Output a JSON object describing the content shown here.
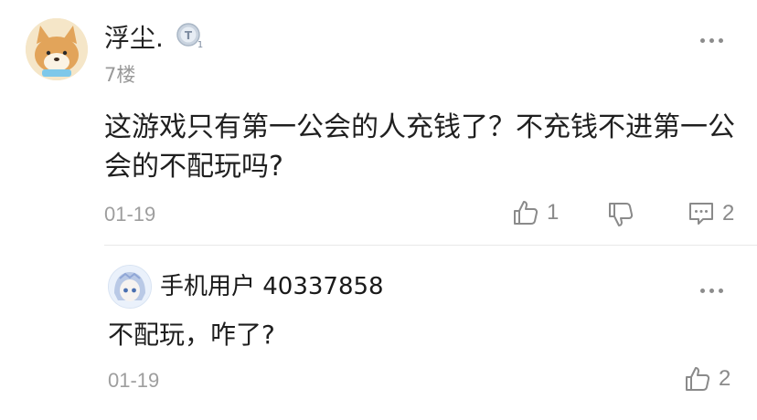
{
  "comment": {
    "username": "浮尘.",
    "badge_icon": "level-badge-icon",
    "floor": "7楼",
    "text": "这游戏只有第一公会的人充钱了？不充钱不进第一公会的不配玩吗?",
    "date": "01-19",
    "like_count": "1",
    "reply_count": "2"
  },
  "reply": {
    "username": "手机用户 40337858",
    "text": "不配玩，咋了?",
    "date": "01-19",
    "like_count": "2"
  },
  "colors": {
    "text_primary": "#1f1f1f",
    "text_secondary": "#9e9e9e",
    "icon_gray": "#8a8a8a",
    "divider": "#e8e8e8"
  }
}
